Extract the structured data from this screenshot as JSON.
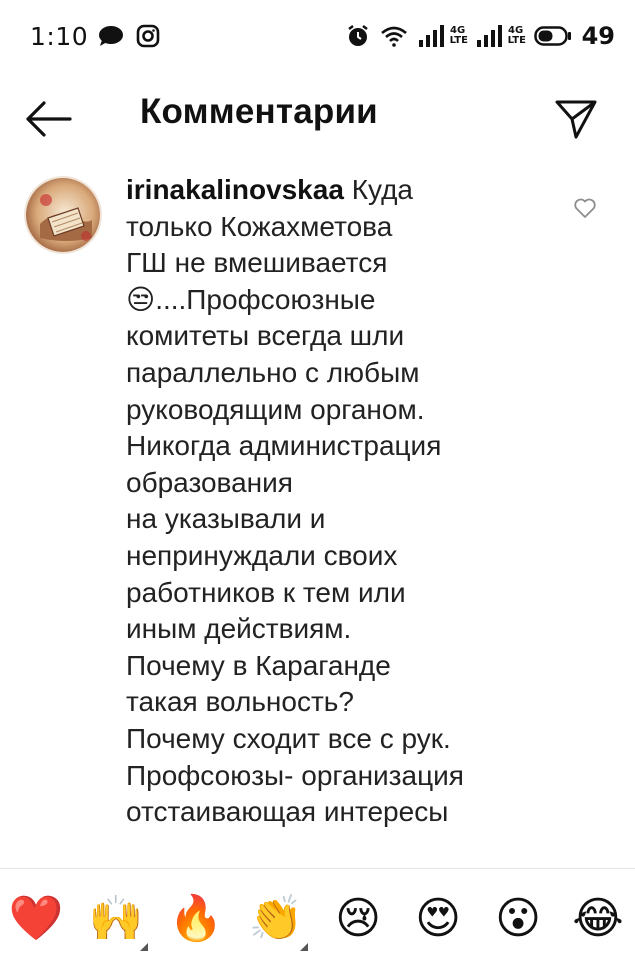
{
  "status_bar": {
    "time": "1:10",
    "battery_level": "49",
    "network_badges": [
      "4G\nLTE",
      "4G\nLTE"
    ]
  },
  "header": {
    "title": "Комментарии",
    "back_icon": "back-arrow-icon",
    "share_icon": "send-paper-plane-icon"
  },
  "comment": {
    "username": "irinakalinovskaa",
    "lines": [
      "Куда",
      "только Кожахметова",
      "ГШ не вмешивается",
      "😒....Профсоюзные",
      "комитеты всегда шли",
      "параллельно с любым",
      "руководящим органом.",
      "Никогда администрация",
      "образования",
      "на указывали и",
      "непринуждали своих",
      "работников к тем или",
      "иным действиям.",
      "Почему в Караганде",
      "такая вольность?",
      "Почему сходит все с рук.",
      "Профсоюзы- организация",
      "отстаивающая интересы"
    ],
    "like_icon": "heart-outline-icon"
  },
  "emoji_bar": {
    "emojis": [
      {
        "char": "❤️",
        "name": "red-heart",
        "has_variants": false
      },
      {
        "char": "🙌",
        "name": "raising-hands",
        "has_variants": true
      },
      {
        "char": "🔥",
        "name": "fire",
        "has_variants": false
      },
      {
        "char": "👏",
        "name": "clapping-hands",
        "has_variants": true
      },
      {
        "char": "😢",
        "name": "crying-face",
        "has_variants": false
      },
      {
        "char": "😍",
        "name": "heart-eyes",
        "has_variants": false
      },
      {
        "char": "😮",
        "name": "astonished-face",
        "has_variants": false
      },
      {
        "char": "😂",
        "name": "tears-of-joy",
        "has_variants": false
      }
    ]
  }
}
